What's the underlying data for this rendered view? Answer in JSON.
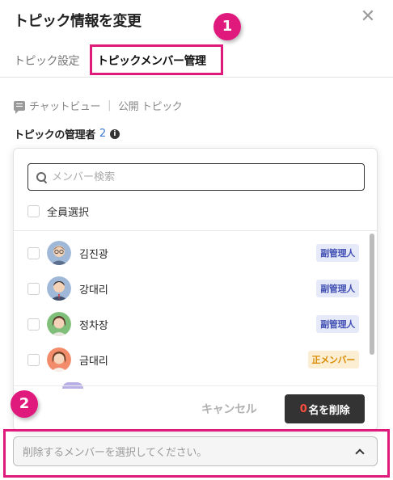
{
  "dialog": {
    "title": "トピック情報を変更",
    "close_icon": "close-icon"
  },
  "markers": [
    "1",
    "2"
  ],
  "tabs": [
    {
      "label": "トピック設定",
      "active": false
    },
    {
      "label": "トピックメンバー管理",
      "active": true
    }
  ],
  "info": {
    "chat_icon": "chat-bubble-icon",
    "chat_view": "チャットビュー",
    "separator": "|",
    "topic_type": "公開 トピック"
  },
  "admins": {
    "label": "トピックの管理者",
    "count": "2",
    "info_icon": "i"
  },
  "member_picker": {
    "search_placeholder": "メンバー検索",
    "select_all_label": "全員選択",
    "members": [
      {
        "name": "김진광",
        "role": "副管理人",
        "role_color": "#4453b5"
      },
      {
        "name": "강대리",
        "role": "副管理人",
        "role_color": "#4453b5"
      },
      {
        "name": "정차장",
        "role": "副管理人",
        "role_color": "#4453b5"
      },
      {
        "name": "금대리",
        "role": "正メンバー",
        "role_color": "#d98a00"
      }
    ],
    "cancel_label": "キャンセル",
    "delete_count": "0",
    "delete_label": "名を削除"
  },
  "removal_select": {
    "placeholder": "削除するメンバーを選択してください。",
    "chevron_icon": "chevron-up-icon"
  },
  "colors": {
    "highlight": "#e0197d",
    "sub_admin_badge_bg": "#e6e9f7",
    "regular_badge_bg": "#fbeed3",
    "delete_button_bg": "#333333"
  }
}
